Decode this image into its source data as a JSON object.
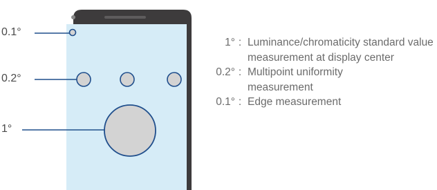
{
  "callouts": [
    {
      "label": "0.1°"
    },
    {
      "label": "0.2°"
    },
    {
      "label": "1°"
    }
  ],
  "legend": [
    {
      "key": "1°",
      "separator": ":",
      "text": "Luminance/chromaticity standard value measurement at display center"
    },
    {
      "key": "0.2°",
      "separator": ":",
      "text": "Multipoint uniformity measurement"
    },
    {
      "key": "0.1°",
      "separator": ":",
      "text": "Edge measurement"
    }
  ],
  "colors": {
    "screen": "#d6ecf7",
    "phone_body": "#3d3b3c",
    "spot_fill": "#d3d3d3",
    "spot_stroke": "#1f4e8c",
    "leader_line": "#1f4e8c",
    "label_text": "#4a4a4a",
    "legend_text": "#6b6b6b"
  }
}
